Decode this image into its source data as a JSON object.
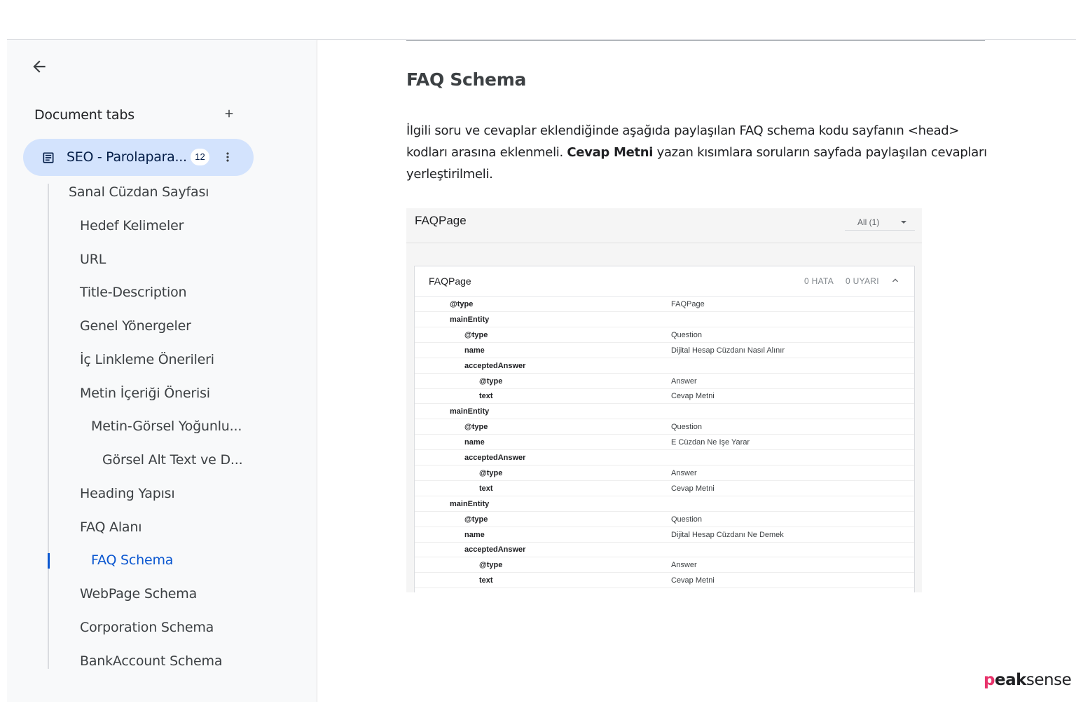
{
  "sidebar": {
    "title": "Document tabs",
    "active_tab": {
      "label": "SEO - Parolapara...",
      "count": "12"
    },
    "items": [
      {
        "label": "Sanal Cüzdan Sayfası",
        "level": 1
      },
      {
        "label": "Hedef Kelimeler",
        "level": 2
      },
      {
        "label": "URL",
        "level": 2
      },
      {
        "label": "Title-Description",
        "level": 2
      },
      {
        "label": "Genel Yönergeler",
        "level": 2
      },
      {
        "label": "İç Linkleme Önerileri",
        "level": 2
      },
      {
        "label": "Metin İçeriği Önerisi",
        "level": 2
      },
      {
        "label": "Metin-Görsel Yoğunlu...",
        "level": 3
      },
      {
        "label": "Görsel Alt Text ve D...",
        "level": 4
      },
      {
        "label": "Heading Yapısı",
        "level": 2
      },
      {
        "label": "FAQ Alanı",
        "level": 2
      },
      {
        "label": "FAQ Schema",
        "level": 3,
        "selected": true
      },
      {
        "label": "WebPage Schema",
        "level": 2
      },
      {
        "label": "Corporation Schema",
        "level": 2
      },
      {
        "label": "BankAccount Schema",
        "level": 2
      }
    ]
  },
  "content": {
    "heading": "FAQ Schema",
    "para_part1": "İlgili soru ve cevaplar eklendiğinde aşağıda paylaşılan FAQ schema kodu sayfanın <head> kodları arasına eklenmeli. ",
    "para_bold": "Cevap Metni",
    "para_part2": " yazan kısımlara soruların sayfada paylaşılan cevapları yerleştirilmeli."
  },
  "schema": {
    "title": "FAQPage",
    "filter": "All (1)",
    "card_title": "FAQPage",
    "errors": "0 HATA",
    "warnings": "0 UYARI",
    "rows": [
      {
        "k": "@type",
        "v": "FAQPage",
        "level": 0
      },
      {
        "k": "mainEntity",
        "v": "",
        "level": 0
      },
      {
        "k": "@type",
        "v": "Question",
        "level": 1
      },
      {
        "k": "name",
        "v": "Dijital Hesap Cüzdanı Nasıl Alınır",
        "level": 1
      },
      {
        "k": "acceptedAnswer",
        "v": "",
        "level": 1
      },
      {
        "k": "@type",
        "v": "Answer",
        "level": 2
      },
      {
        "k": "text",
        "v": "Cevap Metni",
        "level": 2
      },
      {
        "k": "mainEntity",
        "v": "",
        "level": 0
      },
      {
        "k": "@type",
        "v": "Question",
        "level": 1
      },
      {
        "k": "name",
        "v": "E Cüzdan Ne Işe Yarar",
        "level": 1
      },
      {
        "k": "acceptedAnswer",
        "v": "",
        "level": 1
      },
      {
        "k": "@type",
        "v": "Answer",
        "level": 2
      },
      {
        "k": "text",
        "v": "Cevap Metni",
        "level": 2
      },
      {
        "k": "mainEntity",
        "v": "",
        "level": 0
      },
      {
        "k": "@type",
        "v": "Question",
        "level": 1
      },
      {
        "k": "name",
        "v": "Dijital Hesap Cüzdanı Ne Demek",
        "level": 1
      },
      {
        "k": "acceptedAnswer",
        "v": "",
        "level": 1
      },
      {
        "k": "@type",
        "v": "Answer",
        "level": 2
      },
      {
        "k": "text",
        "v": "Cevap Metni",
        "level": 2
      }
    ]
  },
  "logo": {
    "p": "p",
    "eak": "eak",
    "rest": "sense"
  },
  "colors": {
    "accent": "#0b57d0",
    "active_tab_bg": "#d3e3fd",
    "logo_accent": "#e8336b"
  },
  "icons": [
    "arrow-back-icon",
    "plus-icon",
    "document-icon",
    "more-vert-icon",
    "caret-down-icon",
    "chevron-up-icon"
  ]
}
